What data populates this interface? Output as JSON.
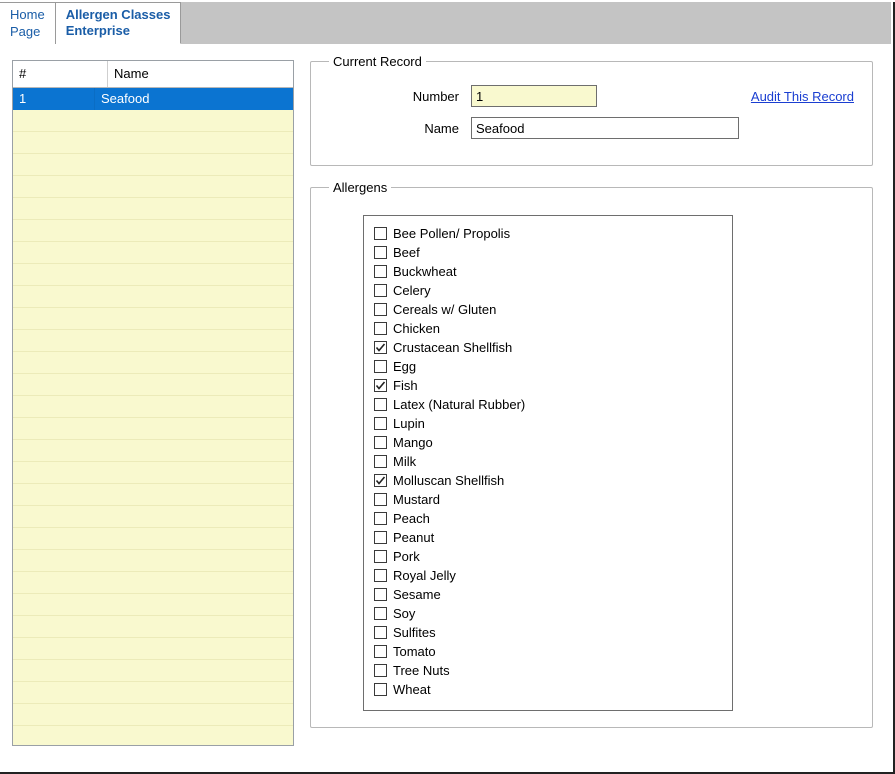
{
  "tabs": [
    {
      "label": "Home\nPage",
      "active": false
    },
    {
      "label": "Allergen Classes\nEnterprise",
      "active": true
    }
  ],
  "grid": {
    "headers": {
      "num": "#",
      "name": "Name"
    },
    "rows": [
      {
        "num": "1",
        "name": "Seafood",
        "selected": true
      }
    ]
  },
  "currentRecord": {
    "legend": "Current Record",
    "numberLabel": "Number",
    "numberValue": "1",
    "nameLabel": "Name",
    "nameValue": "Seafood",
    "auditLink": "Audit This Record"
  },
  "allergens": {
    "legend": "Allergens",
    "items": [
      {
        "label": "Bee Pollen/ Propolis",
        "checked": false
      },
      {
        "label": "Beef",
        "checked": false
      },
      {
        "label": "Buckwheat",
        "checked": false
      },
      {
        "label": "Celery",
        "checked": false
      },
      {
        "label": "Cereals w/ Gluten",
        "checked": false
      },
      {
        "label": "Chicken",
        "checked": false
      },
      {
        "label": "Crustacean Shellfish",
        "checked": true
      },
      {
        "label": "Egg",
        "checked": false
      },
      {
        "label": "Fish",
        "checked": true
      },
      {
        "label": "Latex (Natural Rubber)",
        "checked": false
      },
      {
        "label": "Lupin",
        "checked": false
      },
      {
        "label": "Mango",
        "checked": false
      },
      {
        "label": "Milk",
        "checked": false
      },
      {
        "label": "Molluscan Shellfish",
        "checked": true
      },
      {
        "label": "Mustard",
        "checked": false
      },
      {
        "label": "Peach",
        "checked": false
      },
      {
        "label": "Peanut",
        "checked": false
      },
      {
        "label": "Pork",
        "checked": false
      },
      {
        "label": "Royal Jelly",
        "checked": false
      },
      {
        "label": "Sesame",
        "checked": false
      },
      {
        "label": "Soy",
        "checked": false
      },
      {
        "label": "Sulfites",
        "checked": false
      },
      {
        "label": "Tomato",
        "checked": false
      },
      {
        "label": "Tree Nuts",
        "checked": false
      },
      {
        "label": "Wheat",
        "checked": false
      }
    ]
  }
}
